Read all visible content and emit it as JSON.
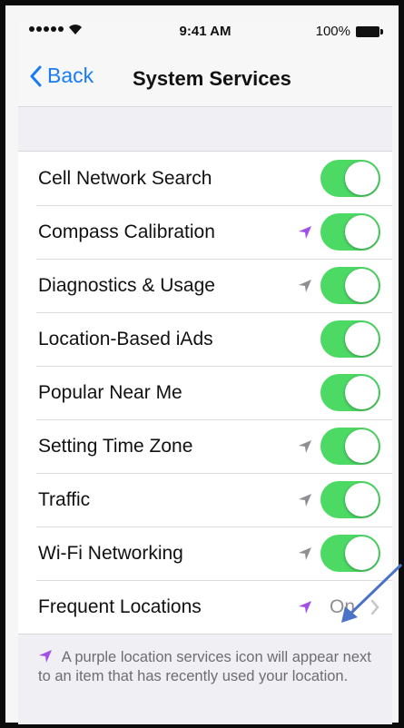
{
  "status_bar": {
    "time": "9:41 AM",
    "battery_percent": "100%"
  },
  "nav": {
    "back_label": "Back",
    "title": "System Services"
  },
  "rows": [
    {
      "label": "Cell Network Search",
      "toggle": "on",
      "location_icon": "none"
    },
    {
      "label": "Compass Calibration",
      "toggle": "on",
      "location_icon": "purple"
    },
    {
      "label": "Diagnostics & Usage",
      "toggle": "on",
      "location_icon": "gray"
    },
    {
      "label": "Location-Based iAds",
      "toggle": "on",
      "location_icon": "none"
    },
    {
      "label": "Popular Near Me",
      "toggle": "on",
      "location_icon": "none"
    },
    {
      "label": "Setting Time Zone",
      "toggle": "on",
      "location_icon": "gray"
    },
    {
      "label": "Traffic",
      "toggle": "on",
      "location_icon": "gray"
    },
    {
      "label": "Wi-Fi Networking",
      "toggle": "on",
      "location_icon": "gray"
    },
    {
      "label": "Frequent Locations",
      "value": "On",
      "location_icon": "purple",
      "disclosure": "chevron-right-icon"
    }
  ],
  "footer": {
    "text": "A purple location services icon will appear next to an item that has recently used your location."
  },
  "colors": {
    "accent": "#1a7cf5",
    "toggle_on": "#4cd964",
    "location_purple": "#a34ee8",
    "location_gray": "#8e8e93",
    "annotation_arrow": "#4a72c8"
  }
}
